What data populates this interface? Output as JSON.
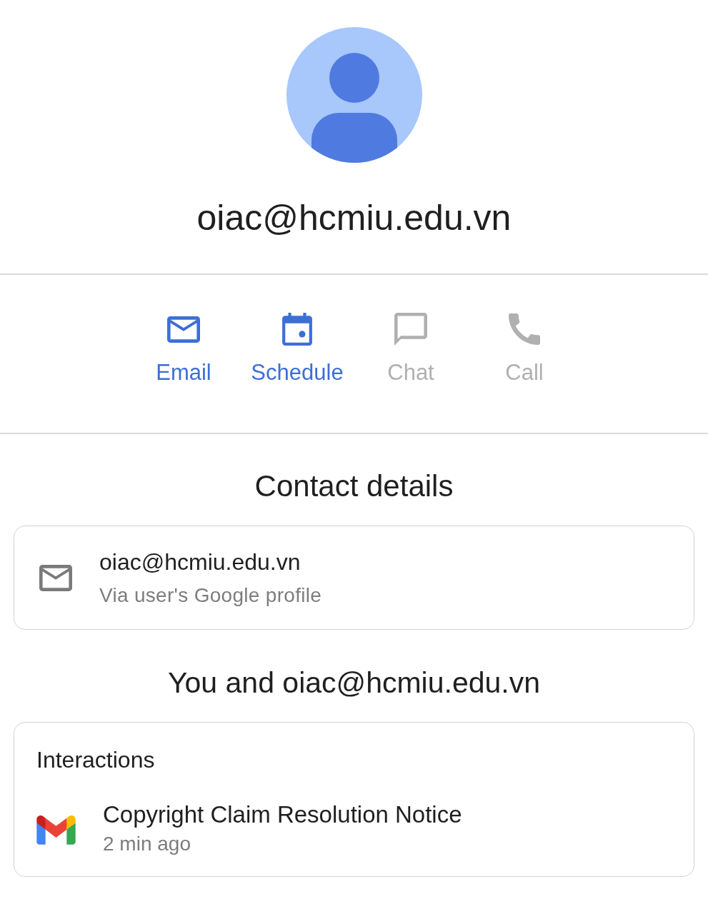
{
  "profile": {
    "title": "oiac@hcmiu.edu.vn"
  },
  "actions": [
    {
      "label": "Email",
      "kind": "email",
      "disabled": false
    },
    {
      "label": "Schedule",
      "kind": "schedule",
      "disabled": false
    },
    {
      "label": "Chat",
      "kind": "chat",
      "disabled": true
    },
    {
      "label": "Call",
      "kind": "call",
      "disabled": true
    }
  ],
  "contact_details": {
    "heading": "Contact details",
    "items": [
      {
        "kind": "email",
        "value": "oiac@hcmiu.edu.vn",
        "source": "Via user's Google profile"
      }
    ]
  },
  "relationship": {
    "heading": "You and oiac@hcmiu.edu.vn",
    "interactions": {
      "heading": "Interactions",
      "items": [
        {
          "kind": "mail",
          "subject": "Copyright Claim Resolution Notice",
          "time": "2 min ago"
        }
      ]
    }
  }
}
